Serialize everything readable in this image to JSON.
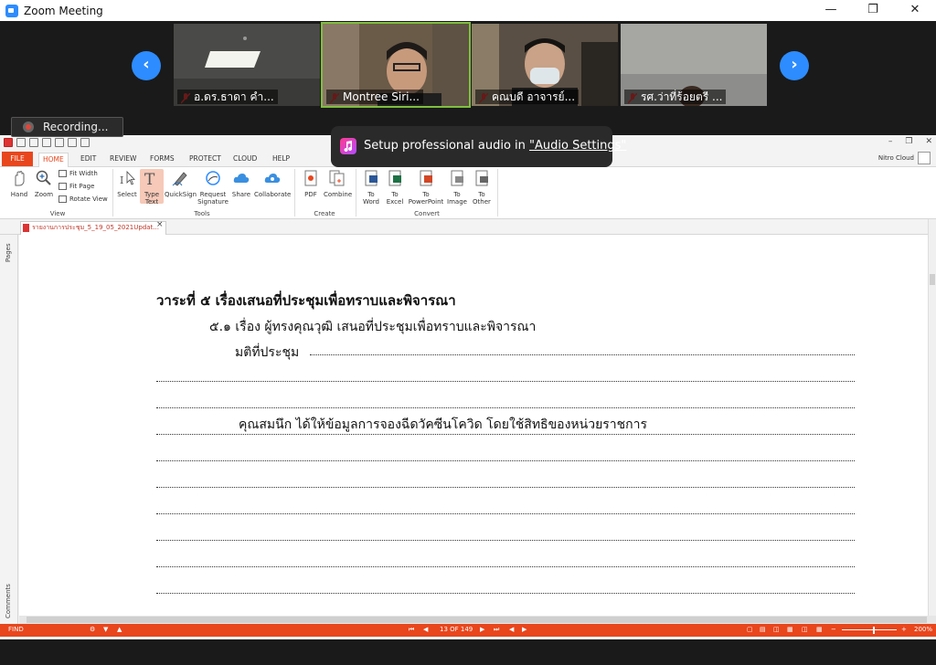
{
  "zoom": {
    "window_title": "Zoom Meeting",
    "minimize": "—",
    "maximize": "❐",
    "close": "✕",
    "prev_arrow": "‹",
    "next_arrow": "›",
    "participants": [
      {
        "name": "อ.ดร.ธาดา  คำ...",
        "muted": true
      },
      {
        "name": "Montree Siri...",
        "muted": true,
        "active": true
      },
      {
        "name": "คณบดี อาจารย์...",
        "muted": true
      },
      {
        "name": "รศ.ว่าที่ร้อยตรี ...",
        "muted": true
      }
    ],
    "recording_label": "Recording...",
    "audio_toast": {
      "prefix": "Setup professional audio in ",
      "link": "\"Audio Settings\""
    },
    "colors": {
      "accent": "#2d8cff",
      "active_border": "#7fbf3f"
    }
  },
  "nitro": {
    "tabs": [
      "FILE",
      "HOME",
      "EDIT",
      "REVIEW",
      "FORMS",
      "PROTECT",
      "CLOUD",
      "HELP"
    ],
    "cloud_label": "Nitro Cloud",
    "app_controls": [
      "–",
      "❐",
      "✕"
    ],
    "ribbon": {
      "hand": "Hand",
      "zoom": "Zoom",
      "fit_width": "Fit Width",
      "fit_page": "Fit Page",
      "rotate_view": "Rotate View",
      "view_group": "View",
      "select": "Select",
      "type_text_1": "Type",
      "type_text_2": "Text",
      "quicksign": "QuickSign",
      "request_1": "Request",
      "request_2": "Signature",
      "share": "Share",
      "collaborate": "Collaborate",
      "tools_group": "Tools",
      "pdf": "PDF",
      "combine": "Combine",
      "create_group": "Create",
      "to_word_1": "To",
      "to_word_2": "Word",
      "to_excel_1": "To",
      "to_excel_2": "Excel",
      "to_ppt_1": "To",
      "to_ppt_2": "PowerPoint",
      "to_image_1": "To",
      "to_image_2": "Image",
      "to_other_1": "To",
      "to_other_2": "Other",
      "convert_group": "Convert"
    },
    "document_tab": "รายงานการประชุม_5_19_05_2021Updat...",
    "doc_close": "×",
    "side_pages": "Pages",
    "side_comments": "Comments",
    "document": {
      "heading": "วาระที่  ๕  เรื่องเสนอที่ประชุมเพื่อทราบและพิจารณา",
      "item": "๕.๑  เรื่อง  ผู้ทรงคุณวุฒิ  เสนอที่ประชุมเพื่อทราบและพิจารณา",
      "resolution": "มติที่ประชุม",
      "note": "คุณสมนึก ได้ให้ข้อมูลการจองฉีดวัคซีนโควิด โดยใช้สิทธิของหน่วยราชการ"
    },
    "status": {
      "find": "FIND",
      "page": "13 OF 149",
      "zoom": "200%"
    },
    "colors": {
      "brand": "#e8461d"
    }
  }
}
